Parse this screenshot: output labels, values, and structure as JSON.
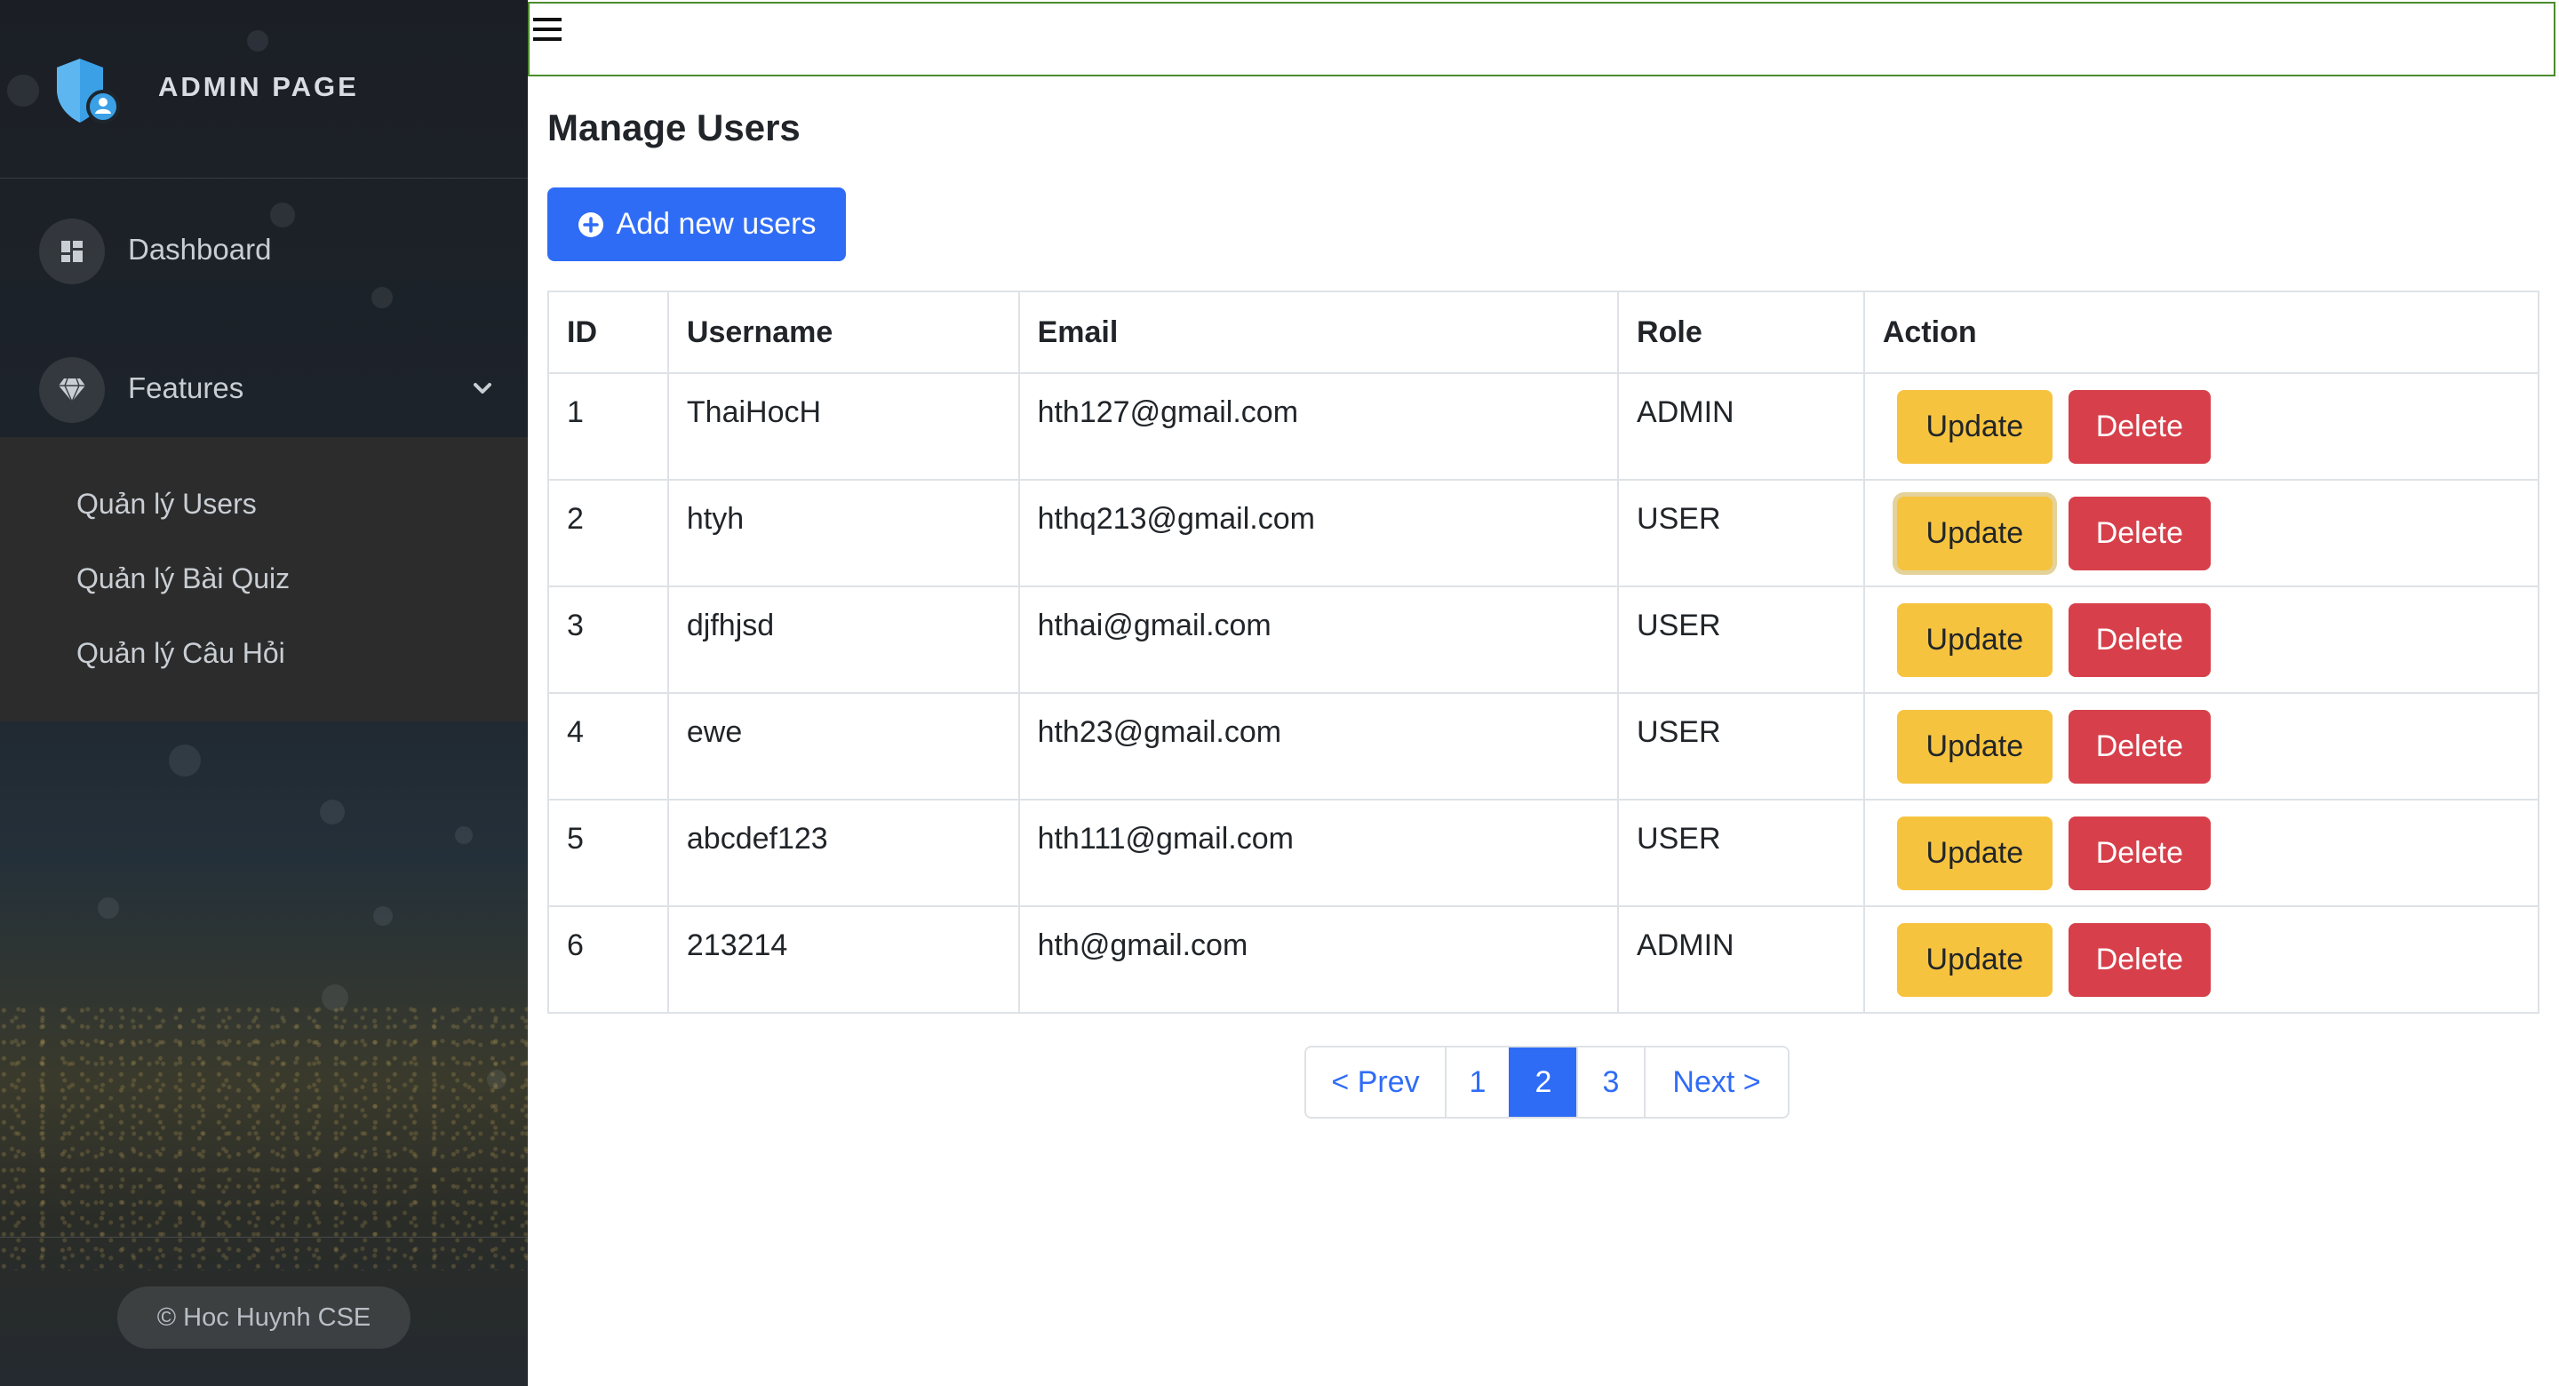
{
  "sidebar": {
    "brand": "ADMIN PAGE",
    "items": [
      {
        "label": "Dashboard",
        "icon": "dashboard-icon"
      },
      {
        "label": "Features",
        "icon": "diamond-icon"
      }
    ],
    "submenu": [
      "Quản lý Users",
      "Quản lý Bài Quiz",
      "Quản lý Câu Hỏi"
    ],
    "footer": "© Hoc Huynh CSE"
  },
  "main": {
    "title": "Manage Users",
    "add_button": "Add new users",
    "columns": [
      "ID",
      "Username",
      "Email",
      "Role",
      "Action"
    ],
    "rows": [
      {
        "id": "1",
        "username": "ThaiHocH",
        "email": "hth127@gmail.com",
        "role": "ADMIN"
      },
      {
        "id": "2",
        "username": "htyh",
        "email": "hthq213@gmail.com",
        "role": "USER"
      },
      {
        "id": "3",
        "username": "djfhjsd",
        "email": "hthai@gmail.com",
        "role": "USER"
      },
      {
        "id": "4",
        "username": "ewe",
        "email": "hth23@gmail.com",
        "role": "USER"
      },
      {
        "id": "5",
        "username": "abcdef123",
        "email": "hth111@gmail.com",
        "role": "USER"
      },
      {
        "id": "6",
        "username": "213214",
        "email": "hth@gmail.com",
        "role": "ADMIN"
      }
    ],
    "update_label": "Update",
    "delete_label": "Delete"
  },
  "pagination": {
    "prev": "< Prev",
    "pages": [
      "1",
      "2",
      "3"
    ],
    "active_page": "2",
    "next": "Next >"
  },
  "colors": {
    "primary": "#2f6cf6",
    "update": "#f6c33f",
    "delete": "#d7404b",
    "sidebar_bg": "#1e252d",
    "shield": "#3ba0e6"
  }
}
